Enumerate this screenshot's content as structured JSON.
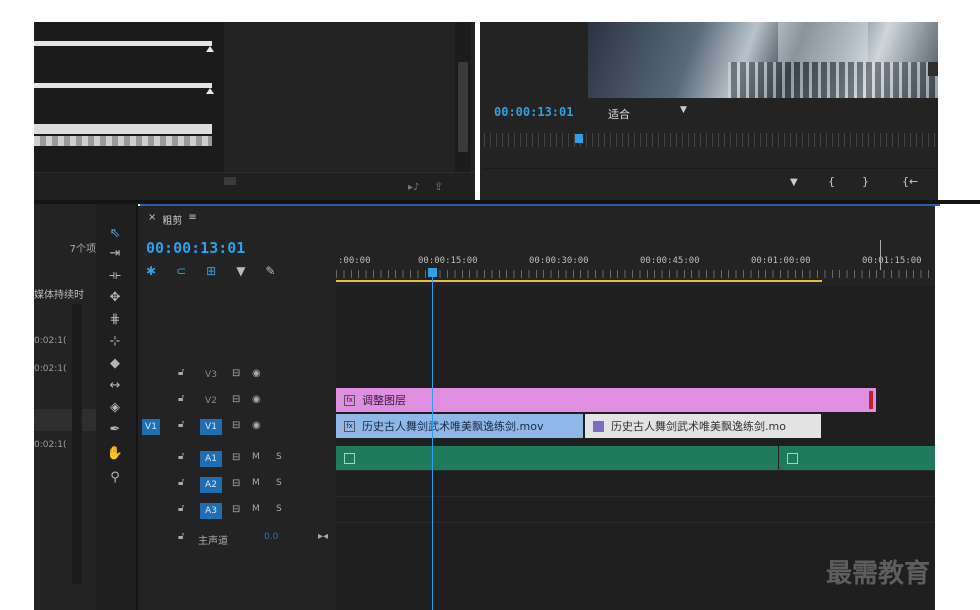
{
  "program_monitor": {
    "timecode": "00:00:13:01",
    "zoom_label": "适合",
    "buttons": {
      "marker": "marker-icon",
      "mark_in": "{",
      "mark_out": "}",
      "go_to_in": "{←"
    }
  },
  "project_panel": {
    "item_count": "7个项",
    "column_header": "媒体持续时",
    "durations": [
      "0:02:1(",
      "0:02:1(",
      "0:02:1("
    ]
  },
  "timeline": {
    "sequence_name": "粗剪",
    "menu_icon": "≡",
    "close_icon": "×",
    "playhead_timecode": "00:00:13:01",
    "ruler_labels": [
      ":00:00",
      "00:00:15:00",
      "00:00:30:00",
      "00:00:45:00",
      "00:01:00:00",
      "00:01:15:00"
    ],
    "tracks": [
      {
        "name": "V3",
        "type": "video",
        "target": ""
      },
      {
        "name": "V2",
        "type": "video",
        "target": ""
      },
      {
        "name": "V1",
        "type": "video",
        "target": "V1"
      },
      {
        "name": "A1",
        "type": "audio",
        "target": ""
      },
      {
        "name": "A2",
        "type": "audio",
        "target": ""
      },
      {
        "name": "A3",
        "type": "audio",
        "target": ""
      }
    ],
    "audio_letters": {
      "mute": "M",
      "solo": "S"
    },
    "master": {
      "label": "主声道",
      "value": "0.0"
    },
    "clips": {
      "adjustment_layer": "调整图层",
      "v1_clip_a": "历史古人舞剑武术唯美飘逸练剑.mov",
      "v1_clip_b": "历史古人舞剑武术唯美飘逸练剑.mo"
    }
  },
  "watermark": "最需教育",
  "colors": {
    "timecode_blue": "#2f9fe8",
    "adjustment_clip": "#e08ee0",
    "video_clip": "#8fb7e8",
    "audio_clip": "#1f7a5c",
    "track_target": "#1e6eb3"
  }
}
